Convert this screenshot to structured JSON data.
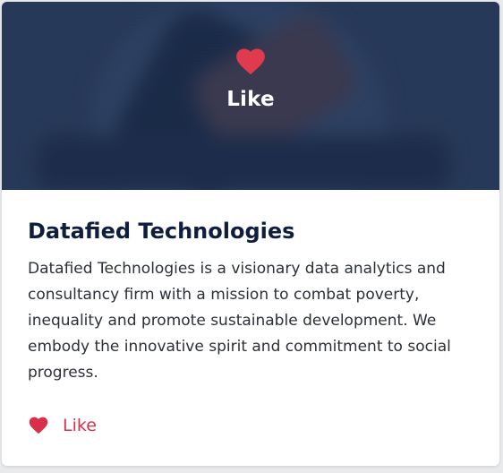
{
  "hero": {
    "like_label": "Like",
    "heart_icon": "heart-icon"
  },
  "card": {
    "title": "Datafied Technologies",
    "description": "Datafied Technologies is a visionary data analytics and consultancy firm with a mission to combat poverty, inequality and promote sustainable development. We embody the innovative spirit and commitment to social progress.",
    "like_label": "Like",
    "like_icon": "heart-icon"
  },
  "colors": {
    "accent": "#d8304a",
    "title": "#0f1e3d",
    "hero_bg": "#2d3f60"
  }
}
